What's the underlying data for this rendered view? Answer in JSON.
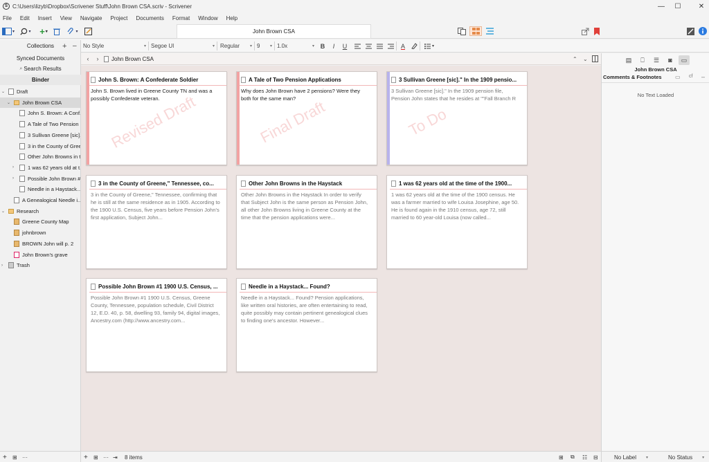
{
  "window": {
    "title": "C:\\Users\\lizyb\\Dropbox\\Scrivener Stuff\\John Brown CSA.scriv - Scrivener",
    "controls": [
      "—",
      "☐",
      "✕"
    ]
  },
  "menu": [
    "File",
    "Edit",
    "Insert",
    "View",
    "Navigate",
    "Project",
    "Documents",
    "Format",
    "Window",
    "Help"
  ],
  "toolbar": {
    "doc_title": "John Brown CSA"
  },
  "formatbar": {
    "style": "No Style",
    "font": "Segoe UI",
    "weight": "Regular",
    "size": "9",
    "spacing": "1.0x",
    "bold": "B",
    "italic": "I",
    "underline": "U",
    "text_color": "A"
  },
  "sidebar": {
    "collections_label": "Collections",
    "synced": "Synced Documents",
    "search_results": "Search Results",
    "binder_label": "Binder",
    "items": [
      {
        "label": "Draft",
        "icon": "draft-icon",
        "disc": "⌄",
        "indent": 0
      },
      {
        "label": "John Brown CSA",
        "icon": "folder-icon",
        "disc": "⌄",
        "indent": 1,
        "selected": true
      },
      {
        "label": "John S. Brown: A Conf...",
        "icon": "document-icon",
        "disc": "",
        "indent": 2
      },
      {
        "label": "A Tale of Two Pension ...",
        "icon": "document-icon",
        "disc": "",
        "indent": 2
      },
      {
        "label": "3 Sullivan Greene [sic]...",
        "icon": "document-icon",
        "disc": "",
        "indent": 2
      },
      {
        "label": "3 in the County of Gree...",
        "icon": "document-icon",
        "disc": "",
        "indent": 2
      },
      {
        "label": "Other John Browns in t...",
        "icon": "document-icon",
        "disc": "",
        "indent": 2
      },
      {
        "label": "1 was 62 years old at t...",
        "icon": "document-icon",
        "disc": "›",
        "indent": 2
      },
      {
        "label": "Possible John Brown #...",
        "icon": "document-icon",
        "disc": "›",
        "indent": 2
      },
      {
        "label": "Needle in a Haystack....",
        "icon": "document-icon",
        "disc": "",
        "indent": 2
      },
      {
        "label": "A Genealogical Needle i...",
        "icon": "document-icon",
        "disc": "",
        "indent": 1
      },
      {
        "label": "Research",
        "icon": "research-icon",
        "disc": "⌄",
        "indent": 0
      },
      {
        "label": "Greene County Map",
        "icon": "image-icon",
        "disc": "",
        "indent": 1
      },
      {
        "label": "johnbrown",
        "icon": "image-icon",
        "disc": "",
        "indent": 1
      },
      {
        "label": "BROWN John will p. 2",
        "icon": "image-icon",
        "disc": "",
        "indent": 1
      },
      {
        "label": "John Brown's grave",
        "icon": "pdf-icon",
        "disc": "",
        "indent": 1
      },
      {
        "label": "Trash",
        "icon": "trash-icon",
        "disc": "›",
        "indent": 0
      }
    ]
  },
  "editor": {
    "header_label": "John Brown CSA"
  },
  "cards": [
    {
      "title": "John S. Brown: A Confederate Soldier",
      "synopsis": "John S. Brown lived in Greene County TN and was a possibly Confederate veteran.",
      "stamp": "Revised Draft",
      "label_color": "#f2a3a3",
      "dark": true
    },
    {
      "title": "A Tale of Two Pension Applications",
      "synopsis": "Why does John Brown have 2 pensions? Were they both for the same man?",
      "stamp": "Final Draft",
      "label_color": "#f2a3a3",
      "dark": true
    },
    {
      "title": "3 Sullivan Greene [sic].\" In the 1909 pensio...",
      "synopsis": "3 Sullivan Greene [sic].\" In the 1909 pension file, Pension John states that he resides at \"\"Fall Branch R",
      "stamp": "To Do",
      "label_color": "#b8b3ec",
      "dark": false
    },
    {
      "title": "3 in the County of Greene,\" Tennessee, co...",
      "synopsis": "3 in the County of Greene,\" Tennessee, confirming that he is still at the same residence as in 1905. According to the 1900 U.S. Census, five years before Pension John's first application, Subject John...",
      "stamp": "",
      "label_color": "",
      "dark": false
    },
    {
      "title": "Other John Browns in the Haystack",
      "synopsis": "Other John Browns in the Haystack In order to verify that Subject John is the same person as Pension John, all other John Browns living in Greene County at the time that the pension applications were...",
      "stamp": "",
      "label_color": "",
      "dark": false
    },
    {
      "title": "1 was 62 years old at the time of the 1900...",
      "synopsis": "1 was 62 years old at the time of the 1900 census. He was a farmer married to wife Louisa Josephine, age 50. He is found again in the 1910 census, age 72, still married to 60 year-old Louisa (now called...",
      "stamp": "",
      "label_color": "",
      "dark": false
    },
    {
      "title": "Possible John Brown #1 1900 U.S. Census, ...",
      "synopsis": "Possible John Brown #1 1900 U.S. Census, Greene County, Tennessee, population schedule, Civil District 12, E.D. 40, p. 58, dwelling 93, family 94, digital images, Ancestry.com (http://www.ancestry.com...",
      "stamp": "",
      "label_color": "",
      "dark": false
    },
    {
      "title": "Needle in a Haystack... Found?",
      "synopsis": "Needle in a Haystack... Found? Pension applications, like written oral histories, are often entertaining to read, quite possibly may contain pertinent genealogical clues to finding one's ancestor. However...",
      "stamp": "",
      "label_color": "",
      "dark": false
    }
  ],
  "inspector": {
    "doc_title": "John Brown CSA",
    "section": "Comments & Footnotes",
    "cf": "cf",
    "empty": "No Text Loaded"
  },
  "footer": {
    "items_count": "8 items",
    "label": "No Label",
    "status": "No Status"
  }
}
